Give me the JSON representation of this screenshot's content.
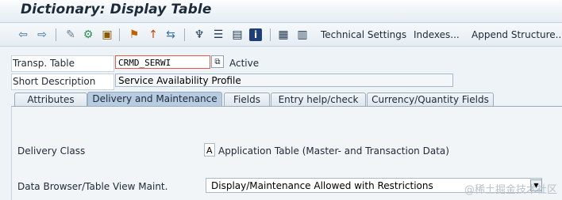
{
  "window": {
    "title": "Dictionary: Display Table"
  },
  "toolbar": {
    "icons": [
      "back-arrow-icon",
      "forward-arrow-icon",
      "display-change-icon",
      "other-object-icon",
      "activate-icon",
      "where-used-icon",
      "object-list-icon",
      "navigation-icon",
      "hierarchy-icon",
      "list-icon",
      "info-icon",
      "layout-icon",
      "grid-icon"
    ],
    "technical_settings_label": "Technical Settings",
    "indexes_label": "Indexes...",
    "append_structure_label": "Append Structure..."
  },
  "header": {
    "transp_table_label": "Transp. Table",
    "transp_table_value": "CRMD_SERWI",
    "status_text": "Active",
    "short_description_label": "Short Description",
    "short_description_value": "Service Availability Profile"
  },
  "tabs": [
    {
      "label": "Attributes",
      "active": false
    },
    {
      "label": "Delivery and Maintenance",
      "active": true
    },
    {
      "label": "Fields",
      "active": false
    },
    {
      "label": "Entry help/check",
      "active": false
    },
    {
      "label": "Currency/Quantity Fields",
      "active": false
    }
  ],
  "delivery": {
    "delivery_class_label": "Delivery Class",
    "delivery_class_value": "A",
    "delivery_class_text": "Application Table (Master- and Transaction Data)",
    "browser_label": "Data Browser/Table View Maint.",
    "browser_value": "Display/Maintenance Allowed with Restrictions"
  },
  "watermark": "@稀土掘金技术社区"
}
